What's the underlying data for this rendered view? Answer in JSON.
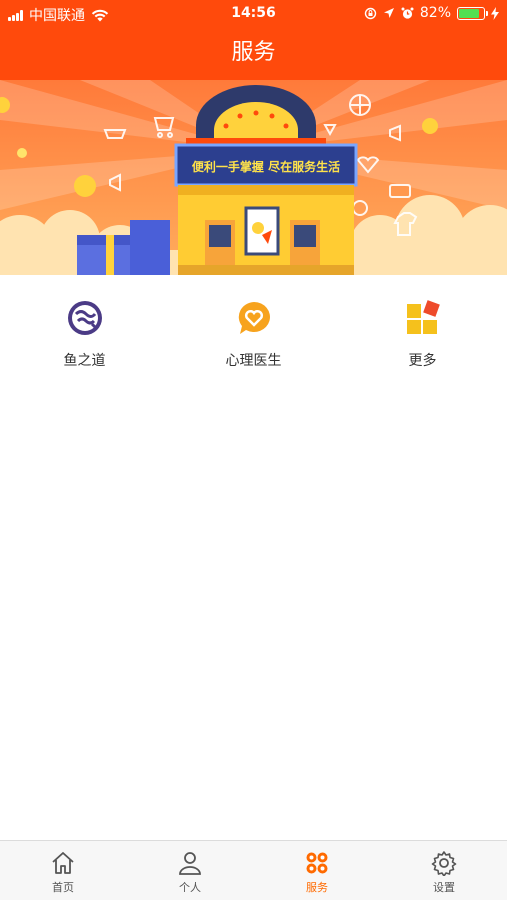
{
  "status_bar": {
    "carrier": "中国联通",
    "time": "14:56",
    "battery": "82%",
    "battery_level": 0.82
  },
  "header": {
    "title": "服务"
  },
  "banner": {
    "slogan": "便利一手掌握  尽在服务生活",
    "colors": {
      "bg_top": "#ff7a3a",
      "bg_bottom": "#ffb066",
      "sign": "#3a56c6"
    }
  },
  "services": [
    {
      "label": "鱼之道",
      "icon": "fish-logo-icon"
    },
    {
      "label": "心理医生",
      "icon": "heart-chat-icon"
    },
    {
      "label": "更多",
      "icon": "more-grid-icon"
    }
  ],
  "tabbar": {
    "tabs": [
      {
        "label": "首页",
        "icon": "home-icon",
        "active": false
      },
      {
        "label": "个人",
        "icon": "person-icon",
        "active": false
      },
      {
        "label": "服务",
        "icon": "service-grid-icon",
        "active": true
      },
      {
        "label": "设置",
        "icon": "gear-icon",
        "active": false
      }
    ],
    "active_color": "#ff6a00"
  },
  "theme": {
    "primary": "#ff4a0c"
  }
}
